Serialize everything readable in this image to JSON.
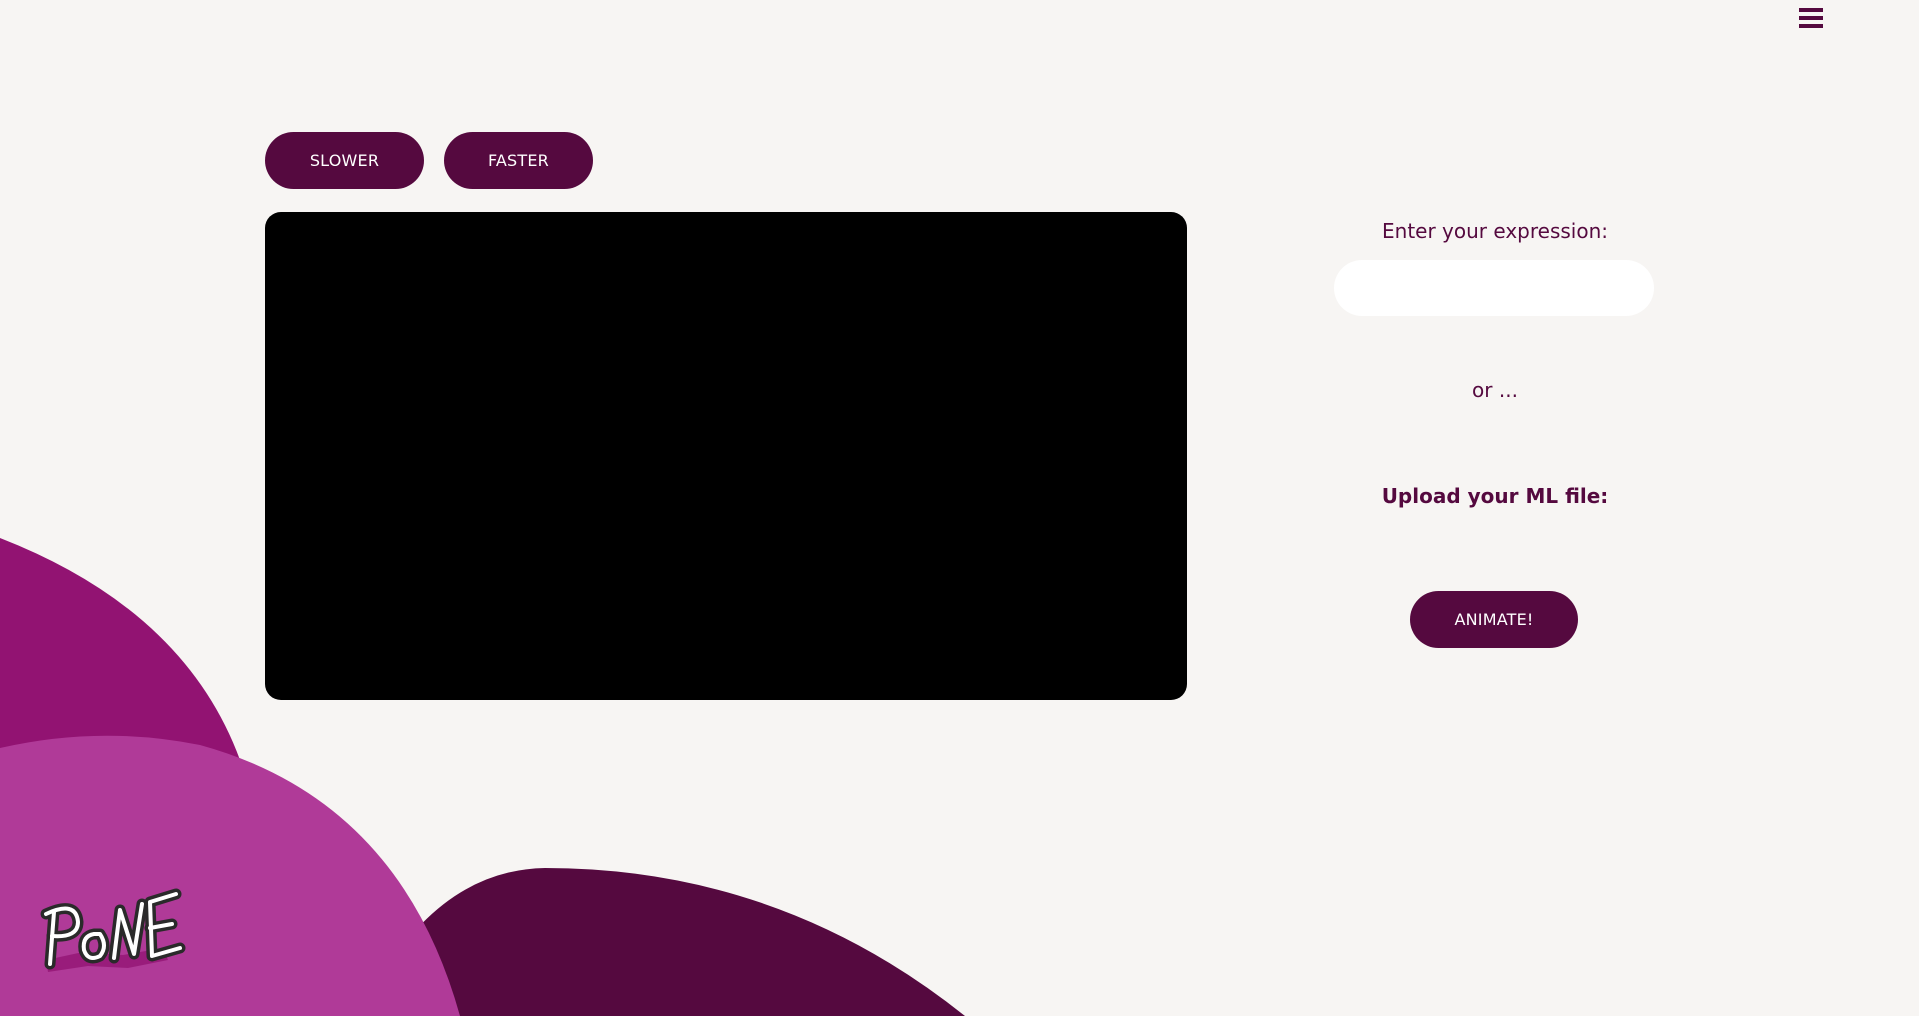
{
  "header": {
    "menu_icon": "hamburger-menu-icon"
  },
  "controls": {
    "slower_label": "SLOWER",
    "faster_label": "FASTER"
  },
  "sidebar": {
    "expression_label": "Enter your expression:",
    "expression_value": "",
    "expression_placeholder": "",
    "or_text": "or ...",
    "upload_label": "Upload your ML file:",
    "animate_label": "ANIMATE!"
  },
  "logo": {
    "text": "PoNE"
  },
  "colors": {
    "background": "#f7f5f3",
    "primary": "#55093f",
    "blob_magenta": "#921372",
    "blob_pink": "#b03a98",
    "canvas": "#000000"
  }
}
